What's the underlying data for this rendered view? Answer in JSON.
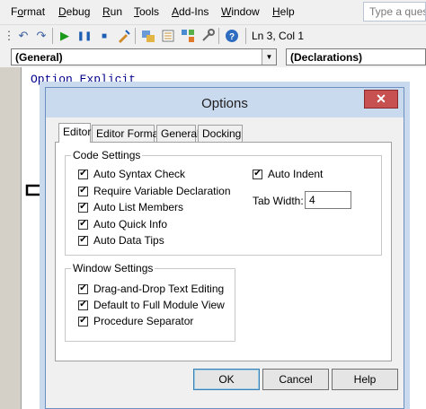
{
  "menu": [
    {
      "label": "Format",
      "u": "o"
    },
    {
      "label": "Debug",
      "u": "D"
    },
    {
      "label": "Run",
      "u": "R"
    },
    {
      "label": "Tools",
      "u": "T"
    },
    {
      "label": "Add-Ins",
      "u": "A"
    },
    {
      "label": "Window",
      "u": "W"
    },
    {
      "label": "Help",
      "u": "H"
    }
  ],
  "help_search": {
    "placeholder": "Type a question for help"
  },
  "toolbar": {
    "position": "Ln 3, Col 1"
  },
  "object_combo": {
    "value": "(General)"
  },
  "procedure_combo": {
    "value": "(Declarations)"
  },
  "code": {
    "line1": "Option Explicit"
  },
  "dialog": {
    "title": "Options",
    "close": "✕",
    "tabs": [
      "Editor",
      "Editor Format",
      "General",
      "Docking"
    ],
    "code_settings": {
      "label": "Code Settings",
      "options": [
        {
          "label": "Auto Syntax Check",
          "checked": true
        },
        {
          "label": "Require Variable Declaration",
          "checked": true
        },
        {
          "label": "Auto List Members",
          "checked": true
        },
        {
          "label": "Auto Quick Info",
          "checked": true
        },
        {
          "label": "Auto Data Tips",
          "checked": true
        }
      ],
      "auto_indent": {
        "label": "Auto Indent",
        "checked": true
      },
      "tab_width": {
        "label": "Tab Width:",
        "value": "4"
      }
    },
    "window_settings": {
      "label": "Window Settings",
      "options": [
        {
          "label": "Drag-and-Drop Text Editing",
          "checked": true
        },
        {
          "label": "Default to Full Module View",
          "checked": true
        },
        {
          "label": "Procedure Separator",
          "checked": true
        }
      ]
    },
    "buttons": {
      "ok": "OK",
      "cancel": "Cancel",
      "help": "Help"
    }
  }
}
